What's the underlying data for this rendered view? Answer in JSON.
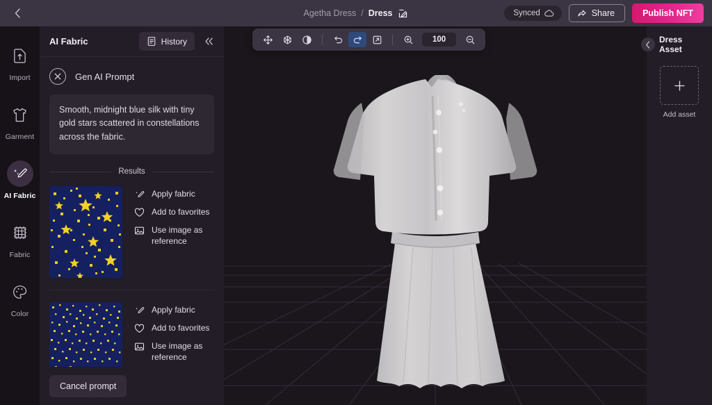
{
  "topbar": {
    "back_icon": "chevron-left-icon",
    "breadcrumb_parent": "Agetha Dress",
    "breadcrumb_sep": "/",
    "breadcrumb_current": "Dress",
    "edit_icon": "pencil-edit-icon",
    "synced_label": "Synced",
    "synced_icon": "cloud-icon",
    "share_label": "Share",
    "share_icon": "share-arrow-icon",
    "publish_label": "Publish NFT",
    "publish_color": "#e0248a",
    "bar_color": "#3b3442"
  },
  "rail": {
    "items": [
      {
        "label": "Import",
        "icon": "file-upload-icon",
        "active": false
      },
      {
        "label": "Garment",
        "icon": "tshirt-icon",
        "active": false
      },
      {
        "label": "AI Fabric",
        "icon": "magic-wand-icon",
        "active": true
      },
      {
        "label": "Fabric",
        "icon": "weave-grid-icon",
        "active": false
      },
      {
        "label": "Color",
        "icon": "palette-icon",
        "active": false
      }
    ]
  },
  "panel": {
    "title": "AI Fabric",
    "history_label": "History",
    "history_icon": "document-list-icon",
    "collapse_icon": "double-chevron-left-icon",
    "prompt_close_icon": "close-circle-icon",
    "prompt_header": "Gen AI Prompt",
    "prompt_text": "Smooth, midnight blue silk with tiny gold stars scattered in constellations across the fabric.",
    "results_label": "Results",
    "results": [
      {
        "name": "fabric-result-1",
        "pattern": "stars-large",
        "base_color": "#152061",
        "star_color": "#f2d128",
        "actions": [
          {
            "label": "Apply fabric",
            "icon": "magic-wand-icon"
          },
          {
            "label": "Add to favorites",
            "icon": "heart-outline-icon"
          },
          {
            "label": "Use image as reference",
            "icon": "image-icon"
          }
        ]
      },
      {
        "name": "fabric-result-2",
        "pattern": "stars-small",
        "base_color": "#152061",
        "star_color": "#e8cc2f",
        "actions": [
          {
            "label": "Apply fabric",
            "icon": "magic-wand-icon"
          },
          {
            "label": "Add to favorites",
            "icon": "heart-outline-icon"
          },
          {
            "label": "Use image as reference",
            "icon": "image-icon"
          }
        ]
      }
    ],
    "cancel_label": "Cancel prompt"
  },
  "toolbar": {
    "move_icon": "move-arrows-icon",
    "orbit_icon": "rotate-gizmo-icon",
    "shading_icon": "contrast-half-circle-icon",
    "undo_icon": "undo-arrow-icon",
    "redo_icon": "redo-arrow-icon",
    "expand_icon": "open-external-icon",
    "zoom_in_icon": "zoom-in-icon",
    "zoom_value": "100",
    "zoom_out_icon": "zoom-out-icon",
    "redo_active": true
  },
  "viewport": {
    "background": "#1a161c",
    "grid_color": "#3a2c3e",
    "garment_name": "dress-3d-model",
    "garment_color": "#cdcbcc"
  },
  "rightpanel": {
    "collapse_icon": "chevron-left-icon",
    "title": "Dress Asset",
    "add_icon": "plus-icon",
    "add_label": "Add asset"
  }
}
